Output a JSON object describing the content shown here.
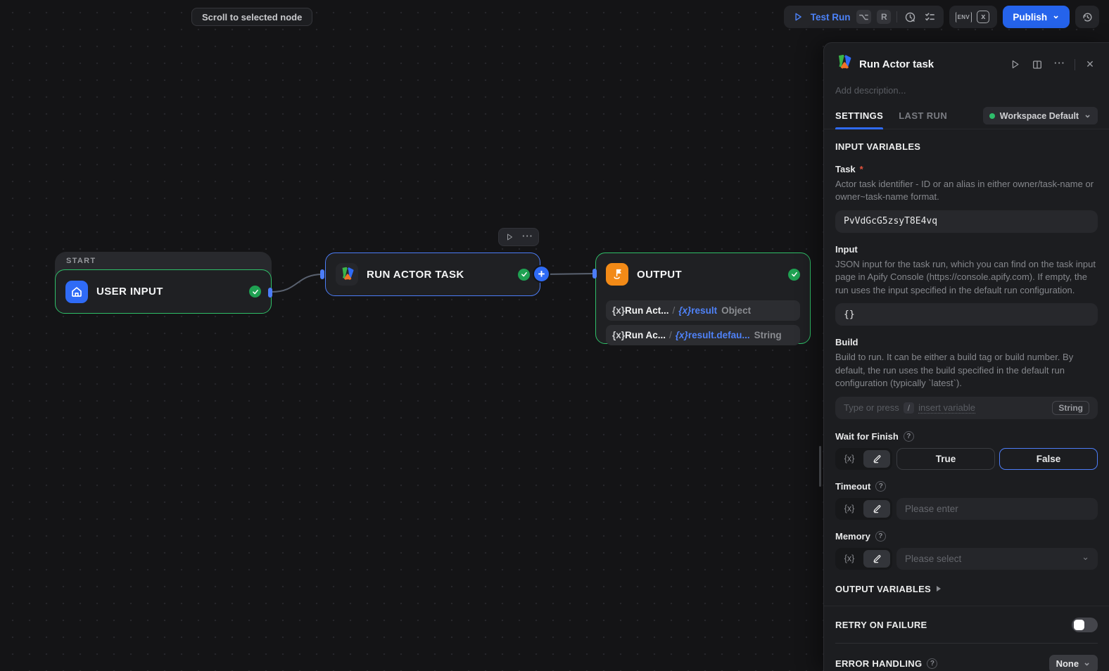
{
  "toolbar": {
    "test_run_label": "Test Run",
    "shortcut_opt": "⌥",
    "shortcut_r": "R",
    "env_label": "ENV",
    "xvar_label": "x",
    "publish_label": "Publish",
    "publish_chevron": "⌄"
  },
  "canvas": {
    "scroll_tooltip": "Scroll to selected node",
    "node_toolbar_dots": "···",
    "start_group_label": "START",
    "user_input": {
      "title": "USER INPUT"
    },
    "run_actor": {
      "title": "RUN ACTOR TASK"
    },
    "output": {
      "title": "OUTPUT",
      "rows": [
        {
          "prefix": "{x}",
          "name": "Run Act...",
          "sep": "/",
          "var_prefix": "{x}",
          "var": "result",
          "type": "Object"
        },
        {
          "prefix": "{x}",
          "name": "Run Ac...",
          "sep": "/",
          "var_prefix": "{x}",
          "var": "result.defau...",
          "type": "String"
        }
      ]
    }
  },
  "panel": {
    "title": "Run Actor task",
    "more_dots": "···",
    "close_glyph": "✕",
    "description_placeholder": "Add description...",
    "tabs": {
      "settings": "SETTINGS",
      "last_run": "LAST RUN"
    },
    "workspace": {
      "label": "Workspace Default",
      "chevron": "⌄"
    },
    "input_variables_header": "INPUT VARIABLES",
    "task": {
      "label": "Task",
      "required_mark": "*",
      "description": "Actor task identifier - ID or an alias in either owner/task-name or owner~task-name format.",
      "value": "PvVdGcG5zsyT8E4vq"
    },
    "input": {
      "label": "Input",
      "description": "JSON input for the task run, which you can find on the task input page in Apify Console (https://console.apify.com). If empty, the run uses the input specified in the default run configuration.",
      "value": "{}"
    },
    "build": {
      "label": "Build",
      "description": "Build to run. It can be either a build tag or build number. By default, the run uses the build specified in the default run configuration (typically `latest`).",
      "placeholder_prefix": "Type or press",
      "slash_key": "/",
      "placeholder_link": "insert variable",
      "type_badge": "String"
    },
    "wait_for_finish": {
      "label": "Wait for Finish",
      "help_glyph": "?",
      "fx": "{x}",
      "true_label": "True",
      "false_label": "False",
      "selected": "False"
    },
    "timeout": {
      "label": "Timeout",
      "help_glyph": "?",
      "fx": "{x}",
      "placeholder": "Please enter"
    },
    "memory": {
      "label": "Memory",
      "help_glyph": "?",
      "fx": "{x}",
      "placeholder": "Please select",
      "chevron": "⌄"
    },
    "output_variables_header": "OUTPUT VARIABLES",
    "retry_header": "RETRY ON FAILURE",
    "retry_toggle_on": false,
    "error_handling": {
      "header": "ERROR HANDLING",
      "help_glyph": "?",
      "value": "None",
      "chevron": "⌄"
    }
  },
  "colors": {
    "accent_blue": "#2f6bf6",
    "edge_gray": "#5a6270",
    "node_green_border": "#2fbf68",
    "check_green": "#1fa152",
    "output_icon_orange": "#f28a17",
    "user_input_icon_blue": "#2f6bf6"
  }
}
